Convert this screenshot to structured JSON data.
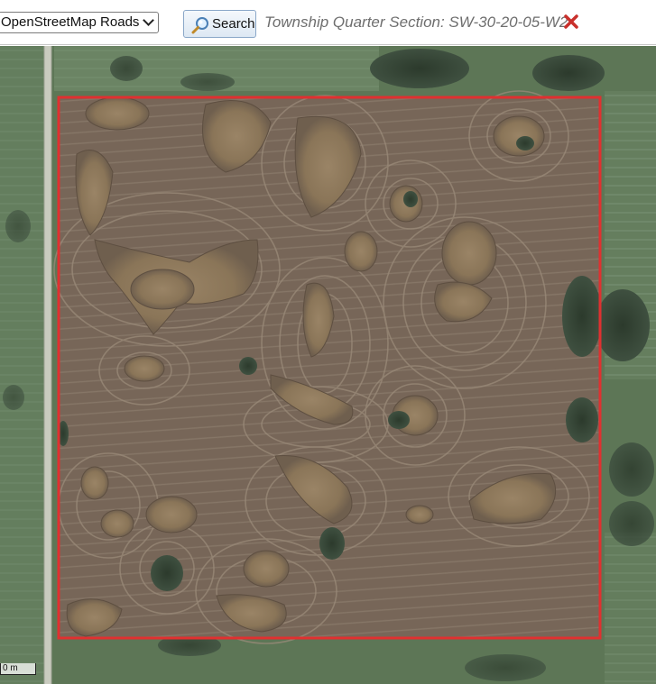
{
  "toolbar": {
    "layer_select": {
      "value": "OpenStreetMap Roads"
    },
    "search_button": {
      "label": "Search",
      "icon": "magnifier-icon"
    },
    "query_text": "Township Quarter Section: SW-30-20-05-W2",
    "clear_icon": "close-icon"
  },
  "map": {
    "basemap": "satellite",
    "highlight": {
      "label": "SW-30-20-05-W2",
      "color": "#e03030"
    },
    "scale_label": "0 m"
  },
  "colors": {
    "field_brown": "#7d6c5c",
    "grass_green": "#5f7857",
    "road": "#c9cbbf",
    "outline_red": "#e03030",
    "clear_red": "#c9302c"
  }
}
